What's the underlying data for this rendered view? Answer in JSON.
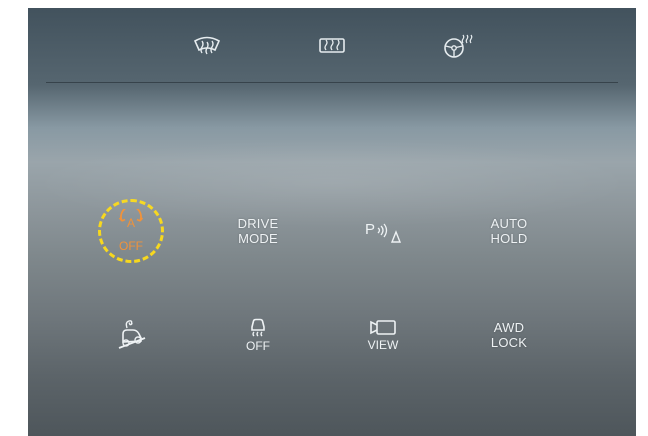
{
  "top_controls": [
    {
      "name": "front-defrost",
      "icon": "front-defrost-icon"
    },
    {
      "name": "rear-defrost",
      "icon": "rear-defrost-icon"
    },
    {
      "name": "heated-steering",
      "icon": "heated-steering-wheel-icon"
    }
  ],
  "buttons": {
    "auto_stop": {
      "icon": "auto-stop-off-icon",
      "letter": "A",
      "state_label": "OFF",
      "highlight_color": "#f7d81e",
      "active_color": "#f0923a"
    },
    "drive_mode": {
      "line1": "DRIVE",
      "line2": "MODE"
    },
    "parking_sensor": {
      "icon": "parking-sensor-icon",
      "letter": "P"
    },
    "auto_hold": {
      "line1": "AUTO",
      "line2": "HOLD"
    },
    "hill_descent": {
      "icon": "hill-descent-control-icon"
    },
    "traction_off": {
      "icon": "esc-off-icon",
      "label": "OFF"
    },
    "camera_view": {
      "icon": "camera-icon",
      "label": "VIEW"
    },
    "awd_lock": {
      "line1": "AWD",
      "line2": "LOCK"
    }
  },
  "colors": {
    "text": "#eef2f4",
    "accent_orange": "#f0923a",
    "highlight_yellow": "#f7d81e"
  }
}
